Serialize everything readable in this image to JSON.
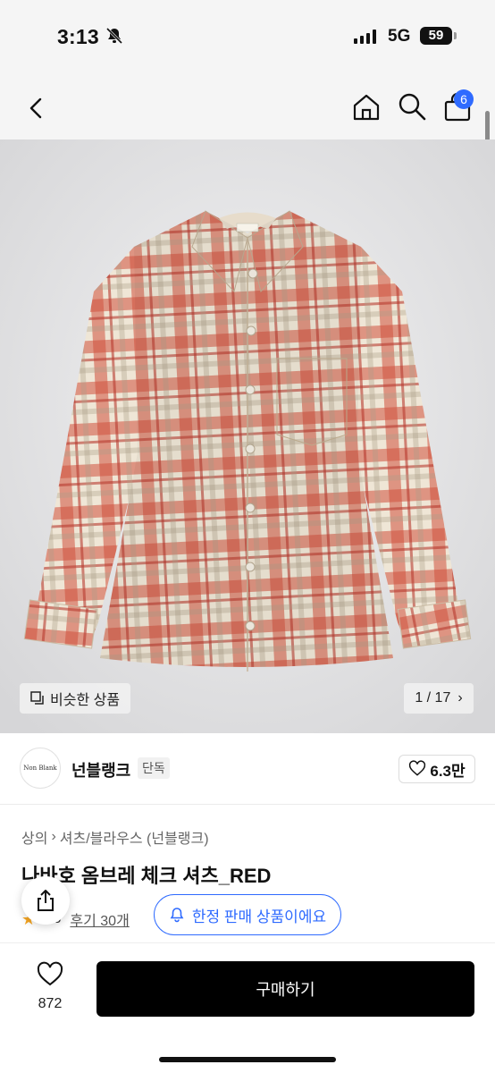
{
  "status_bar": {
    "time": "3:13",
    "network": "5G",
    "battery": "59"
  },
  "header": {
    "icons": [
      "back-icon",
      "home-icon",
      "search-icon",
      "cart-icon"
    ],
    "cart_badge": "6"
  },
  "gallery": {
    "similar_label": "비슷한 상품",
    "pager": "1 / 17",
    "shirt_colors": {
      "base": "#efe6d6",
      "check": "#d0503c",
      "dark": "#b83a2e"
    }
  },
  "brand": {
    "logo_text": "Non Blank",
    "name": "넌블랭크",
    "tag": "단독",
    "likes": "6.3만"
  },
  "breadcrumb": {
    "category": "상의",
    "subcategory": "셔츠/블라우스 (넌블랭크)"
  },
  "product": {
    "title": "나바호 옴브레 체크 셔츠_RED",
    "rating": "4.8",
    "reviews": "후기 30개",
    "limited_label": "한정 판매 상품이에요"
  },
  "bottom_bar": {
    "wish_count": "872",
    "buy_label": "구매하기"
  },
  "colors": {
    "accent": "#2f6bff",
    "buy_button": "#000000",
    "star": "#f5a623"
  }
}
